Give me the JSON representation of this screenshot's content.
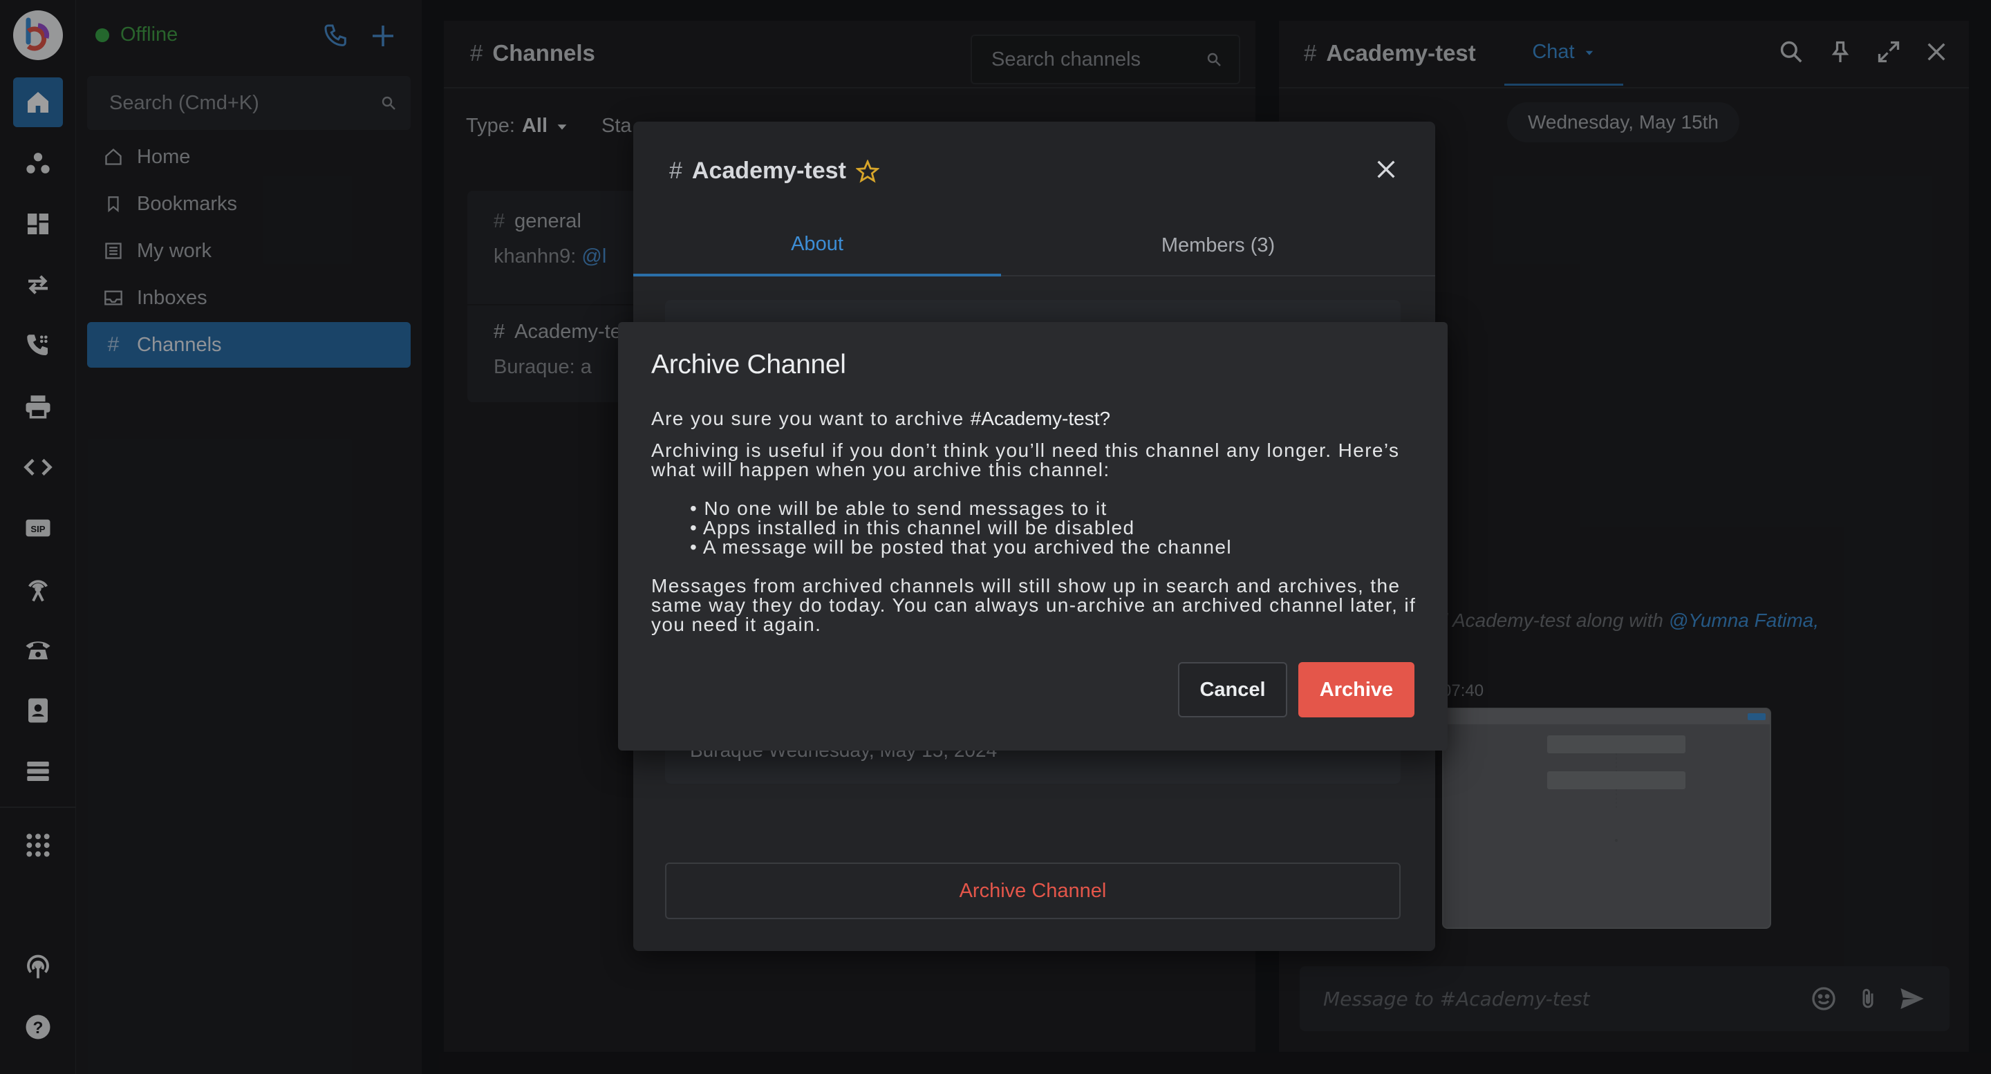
{
  "sidebar": {
    "status": "Offline",
    "search_placeholder": "Search (Cmd+K)",
    "nav": [
      {
        "label": "Home"
      },
      {
        "label": "Bookmarks"
      },
      {
        "label": "My work"
      },
      {
        "label": "Inboxes"
      },
      {
        "label": "Channels"
      }
    ]
  },
  "channels_panel": {
    "title": "Channels",
    "search_placeholder": "Search channels",
    "filter_type_label": "Type:",
    "filter_type_value": "All",
    "filter_status_label": "Sta",
    "channels": [
      {
        "name": "general",
        "preview_user": "khanhn9:",
        "preview_text": "@l"
      },
      {
        "name": "Academy-te",
        "preview_user": "Buraque:",
        "preview_text": "a"
      }
    ]
  },
  "chat": {
    "title": "Academy-test",
    "tab_label": "Chat",
    "date_divider": "Wednesday, May 15th",
    "system_message": "l Academy-test along with ",
    "system_mention": "@Yumna Fatima,",
    "timestamp": "07:40",
    "composer_placeholder": "Message to #Academy-test"
  },
  "channel_modal": {
    "title": "Academy-test",
    "tabs": {
      "about": "About",
      "members": "Members (3)"
    },
    "created_text": "Buraque Wednesday, May 15, 2024",
    "archive_button": "Archive Channel"
  },
  "archive_dialog": {
    "title": "Archive Channel",
    "question_prefix": "Are you sure you want to archive ",
    "channel_ref": "#Academy-test?",
    "intro": "Archiving is useful if you don’t think you’ll need this channel any longer. Here’s what will happen when you archive this channel:",
    "consequences": [
      "No one will be able to send messages to it",
      "Apps installed in this channel will be disabled",
      "A message will be posted that you archived the channel"
    ],
    "footer": "Messages from archived channels will still show up in search and archives, the same way they do today. You can always un-archive an archived channel later, if you need it again.",
    "cancel_label": "Cancel",
    "confirm_label": "Archive"
  },
  "colors": {
    "accent": "#2b6fa8",
    "link": "#3d8ed6",
    "danger": "#e4564a",
    "online": "#3aa64a"
  }
}
